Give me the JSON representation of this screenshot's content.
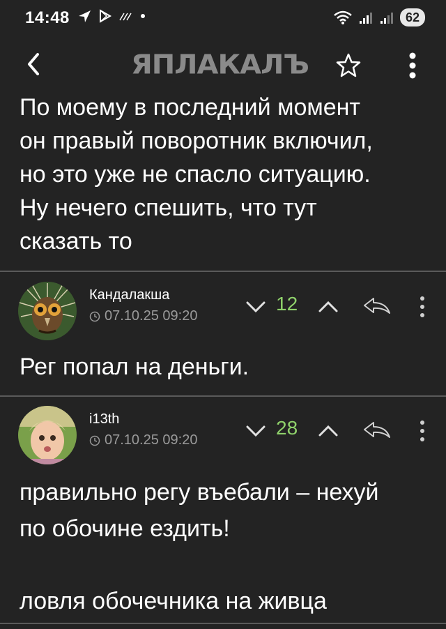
{
  "status_bar": {
    "time": "14:48",
    "battery": "62",
    "left_icons": [
      "navigation-icon",
      "play-store-icon",
      "signal-wave-icon"
    ],
    "right_icons": [
      "wifi-icon",
      "cell-signal-icon",
      "cell-signal-roaming-icon"
    ]
  },
  "app_bar": {
    "logo_text": "ЯПЛАКАЛЪ",
    "icons": [
      "back-icon",
      "star-icon",
      "more-vertical-icon"
    ]
  },
  "post": {
    "text": "По моему в последний момент\nон правый поворотник включил,\nно это уже не спасло ситуацию.\nНу нечего спешить, что тут\nсказать то"
  },
  "comments": [
    {
      "author": "Кандалакша",
      "datetime": "07.10.25 09:20",
      "score": "12",
      "text": "Рег попал на деньги."
    },
    {
      "author": "i13th",
      "datetime": "07.10.25 09:20",
      "score": "28",
      "text": "правильно регу въебали – нехуй\nпо обочине ездить!\n\nловля обочечника на живца"
    }
  ],
  "colors": {
    "background": "#232323",
    "score": "#8fd16b",
    "meta": "#9a9a9a",
    "divider": "#5a5a5a"
  }
}
